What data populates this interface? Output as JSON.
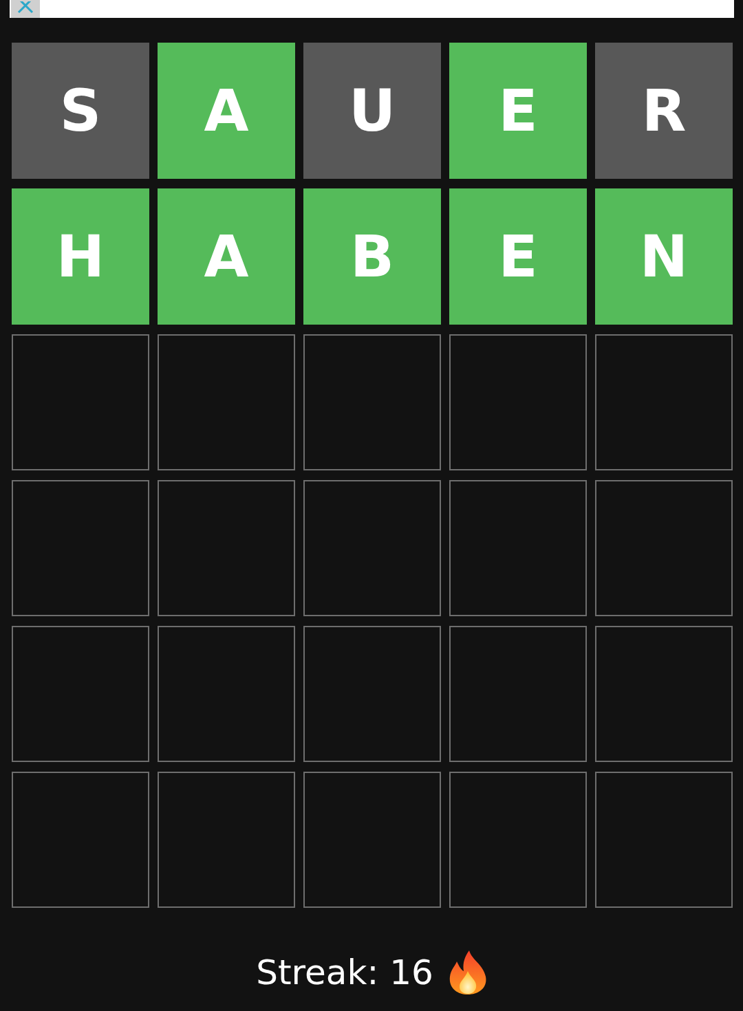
{
  "ad_banner": {
    "close_button": true
  },
  "board": [
    [
      {
        "letter": "S",
        "kind": "absent"
      },
      {
        "letter": "A",
        "kind": "correct"
      },
      {
        "letter": "U",
        "kind": "absent"
      },
      {
        "letter": "E",
        "kind": "correct"
      },
      {
        "letter": "R",
        "kind": "absent"
      }
    ],
    [
      {
        "letter": "H",
        "kind": "correct"
      },
      {
        "letter": "A",
        "kind": "correct"
      },
      {
        "letter": "B",
        "kind": "correct"
      },
      {
        "letter": "E",
        "kind": "correct"
      },
      {
        "letter": "N",
        "kind": "correct"
      }
    ],
    [
      {
        "kind": "empty"
      },
      {
        "kind": "empty"
      },
      {
        "kind": "empty"
      },
      {
        "kind": "empty"
      },
      {
        "kind": "empty"
      }
    ],
    [
      {
        "kind": "empty"
      },
      {
        "kind": "empty"
      },
      {
        "kind": "empty"
      },
      {
        "kind": "empty"
      },
      {
        "kind": "empty"
      }
    ],
    [
      {
        "kind": "empty"
      },
      {
        "kind": "empty"
      },
      {
        "kind": "empty"
      },
      {
        "kind": "empty"
      },
      {
        "kind": "empty"
      }
    ],
    [
      {
        "kind": "empty"
      },
      {
        "kind": "empty"
      },
      {
        "kind": "empty"
      },
      {
        "kind": "empty"
      },
      {
        "kind": "empty"
      }
    ]
  ],
  "streak": {
    "text": "Streak: 16"
  }
}
